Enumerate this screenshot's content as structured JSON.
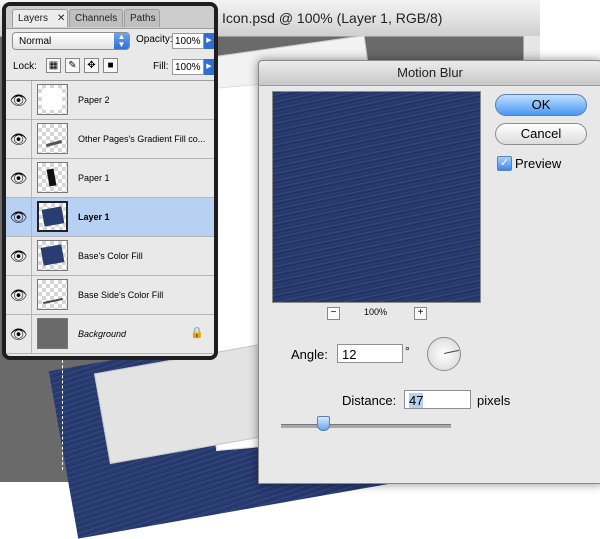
{
  "document": {
    "title": "Icon.psd @ 100% (Layer 1, RGB/8)"
  },
  "layers_panel": {
    "tabs": [
      {
        "label": "Layers"
      },
      {
        "label": "Channels"
      },
      {
        "label": "Paths"
      }
    ],
    "close_glyph": "✕",
    "blend_mode": "Normal",
    "opacity_label": "Opacity:",
    "opacity_value": "100%",
    "lock_label": "Lock:",
    "fill_label": "Fill:",
    "fill_value": "100%",
    "layers": [
      {
        "name": "Paper 2",
        "selected": false
      },
      {
        "name": "Other Pages's Gradient Fill co...",
        "selected": false
      },
      {
        "name": "Paper 1",
        "selected": false
      },
      {
        "name": "Layer 1",
        "selected": true
      },
      {
        "name": "Base's Color Fill",
        "selected": false
      },
      {
        "name": "Base Side's Color Fill",
        "selected": false
      },
      {
        "name": "Background",
        "selected": false,
        "locked": true
      }
    ]
  },
  "dialog": {
    "title": "Motion Blur",
    "ok_label": "OK",
    "cancel_label": "Cancel",
    "preview_label": "Preview",
    "preview_checked": true,
    "zoom_level": "100%",
    "zoom_minus": "−",
    "zoom_plus": "+",
    "angle_label": "Angle:",
    "angle_value": "12",
    "degree_symbol": "°",
    "distance_label": "Distance:",
    "distance_value": "47",
    "distance_unit": "pixels"
  },
  "colors": {
    "accent_blue": "#2f6fd1",
    "selection_blue": "#b8d0f2",
    "preview_navy": "#2a3d70"
  },
  "icons": {
    "visibility": "eye-icon",
    "lock": "lock-icon",
    "checkmark": "checkmark-icon"
  }
}
